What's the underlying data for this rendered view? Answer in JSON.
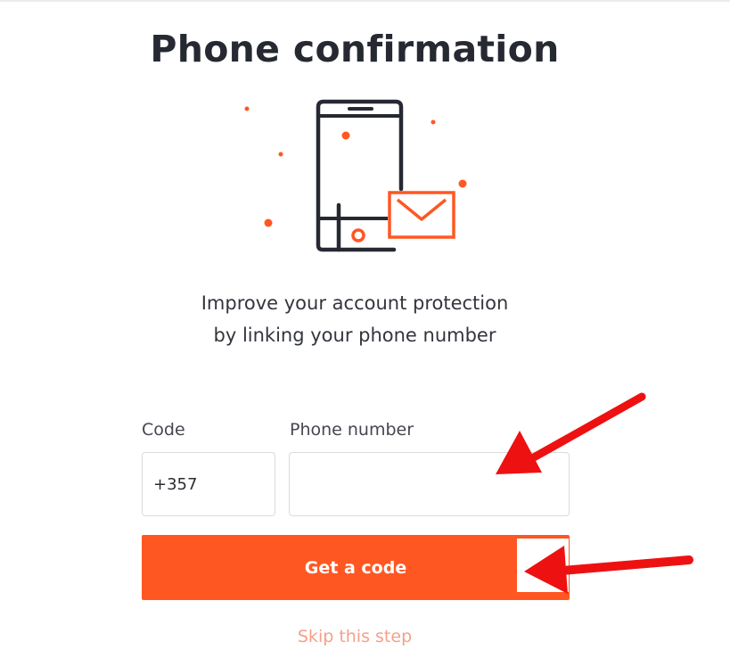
{
  "header": {
    "title": "Phone confirmation"
  },
  "illustration": {
    "icon": "phone-with-envelope-icon",
    "colors": {
      "outline": "#262932",
      "accent": "#ff5722"
    }
  },
  "intro": {
    "line1": "Improve your account protection",
    "line2": "by linking your phone number"
  },
  "form": {
    "code": {
      "label": "Code",
      "value": "+357"
    },
    "phone": {
      "label": "Phone number",
      "value": ""
    },
    "submit_label": "Get a code",
    "skip_label": "Skip this step"
  },
  "annotations": {
    "arrow_color": "#ee1111"
  },
  "colors": {
    "brand": "#ff5722",
    "skip_text": "#f4a08a",
    "input_border": "#d9dbe0"
  }
}
